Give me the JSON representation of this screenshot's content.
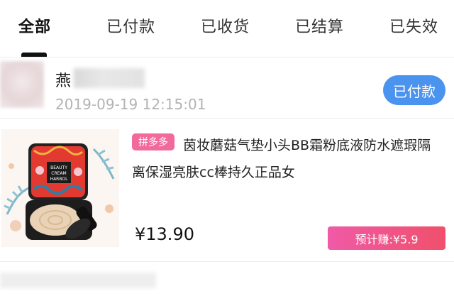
{
  "tabs": [
    {
      "label": "全部",
      "active": true
    },
    {
      "label": "已付款",
      "active": false
    },
    {
      "label": "已收货",
      "active": false
    },
    {
      "label": "已结算",
      "active": false
    },
    {
      "label": "已失效",
      "active": false
    }
  ],
  "order": {
    "user_name_visible": "燕",
    "time": "2019-09-19 12:15:01",
    "status": "已付款",
    "product": {
      "platform_tag": "拼多多",
      "title": "茵妆蘑菇气垫小头BB霜粉底液防水遮瑕隔离保湿亮肤cc棒持久正品女",
      "price": "¥13.90",
      "earn": "预计赚:¥5.9",
      "image_text": "BEAUTY CREAM HARBOL"
    }
  },
  "colors": {
    "status_badge": "#4a93ee",
    "platform_tag": "#f26a9b",
    "earn_badge_start": "#f05aa7",
    "earn_badge_end": "#f0506b"
  }
}
